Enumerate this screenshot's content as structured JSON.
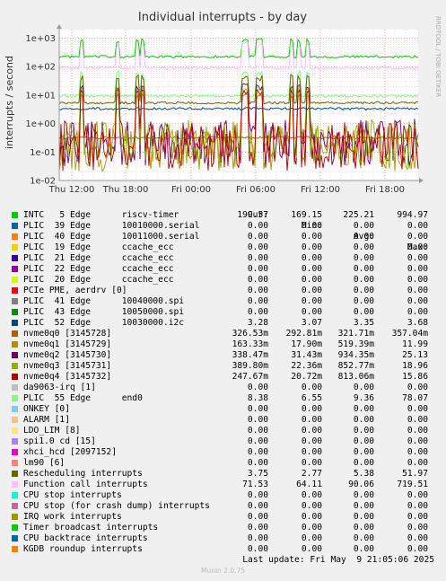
{
  "chart_data": {
    "type": "line",
    "title": "Individual interrupts - by day",
    "ylabel": "interrupts / second",
    "xlabel": "",
    "scale": "log",
    "ylim": [
      0.01,
      2000
    ],
    "grid": true,
    "y_ticks": [
      "1e+03",
      "1e+02",
      "1e+01",
      "1e+00",
      "1e-01",
      "1e-02"
    ],
    "x_ticks": [
      "Thu 12:00",
      "Thu 18:00",
      "Fri 00:00",
      "Fri 06:00",
      "Fri 12:00",
      "Fri 18:00"
    ],
    "side_label": "RRDTOOL / TOBI OETIKER",
    "columns": [
      "Cur:",
      "Min:",
      "Avg:",
      "Max:"
    ],
    "series": [
      {
        "name": "INTC   5 Edge      riscv-timer",
        "color": "#00cc00",
        "cur": "199.57",
        "min": "169.15",
        "avg": "225.21",
        "max": "994.97"
      },
      {
        "name": "PLIC  39 Edge      10010000.serial",
        "color": "#0066b3",
        "cur": "0.00",
        "min": "0.00",
        "avg": "0.00",
        "max": "0.00"
      },
      {
        "name": "PLIC  40 Edge      10011000.serial",
        "color": "#ff8000",
        "cur": "0.00",
        "min": "0.00",
        "avg": "0.00",
        "max": "0.00"
      },
      {
        "name": "PLIC  19 Edge      ccache_ecc",
        "color": "#ffcc00",
        "cur": "0.00",
        "min": "0.00",
        "avg": "0.00",
        "max": "0.00"
      },
      {
        "name": "PLIC  21 Edge      ccache_ecc",
        "color": "#330099",
        "cur": "0.00",
        "min": "0.00",
        "avg": "0.00",
        "max": "0.00"
      },
      {
        "name": "PLIC  22 Edge      ccache_ecc",
        "color": "#990099",
        "cur": "0.00",
        "min": "0.00",
        "avg": "0.00",
        "max": "0.00"
      },
      {
        "name": "PLIC  20 Edge      ccache_ecc",
        "color": "#ccff00",
        "cur": "0.00",
        "min": "0.00",
        "avg": "0.00",
        "max": "0.00"
      },
      {
        "name": "PCIe PME, aerdrv [0]",
        "color": "#ff0000",
        "cur": "0.00",
        "min": "0.00",
        "avg": "0.00",
        "max": "0.00"
      },
      {
        "name": "PLIC  41 Edge      10040000.spi",
        "color": "#808080",
        "cur": "0.00",
        "min": "0.00",
        "avg": "0.00",
        "max": "0.00"
      },
      {
        "name": "PLIC  43 Edge      10050000.spi",
        "color": "#008f00",
        "cur": "0.00",
        "min": "0.00",
        "avg": "0.00",
        "max": "0.00"
      },
      {
        "name": "PLIC  52 Edge      10030000.i2c",
        "color": "#00487d",
        "cur": "3.28",
        "min": "3.07",
        "avg": "3.35",
        "max": "3.68"
      },
      {
        "name": "nvme0q0 [3145728]",
        "color": "#b35a00",
        "cur": "326.53m",
        "min": "292.81m",
        "avg": "321.71m",
        "max": "357.04m"
      },
      {
        "name": "nvme0q1 [3145729]",
        "color": "#b38f00",
        "cur": "163.33m",
        "min": "17.90m",
        "avg": "519.39m",
        "max": "11.99"
      },
      {
        "name": "nvme0q2 [3145730]",
        "color": "#6b006b",
        "cur": "338.47m",
        "min": "31.43m",
        "avg": "934.35m",
        "max": "25.13"
      },
      {
        "name": "nvme0q3 [3145731]",
        "color": "#8fb300",
        "cur": "389.80m",
        "min": "22.36m",
        "avg": "852.77m",
        "max": "18.96"
      },
      {
        "name": "nvme0q4 [3145732]",
        "color": "#b30000",
        "cur": "247.67m",
        "min": "20.72m",
        "avg": "813.06m",
        "max": "15.86"
      },
      {
        "name": "da9063-irq [1]",
        "color": "#bebebe",
        "cur": "0.00",
        "min": "0.00",
        "avg": "0.00",
        "max": "0.00"
      },
      {
        "name": "PLIC  55 Edge      end0",
        "color": "#80ff80",
        "cur": "8.38",
        "min": "6.55",
        "avg": "9.36",
        "max": "78.07"
      },
      {
        "name": "ONKEY [0]",
        "color": "#80c9ff",
        "cur": "0.00",
        "min": "0.00",
        "avg": "0.00",
        "max": "0.00"
      },
      {
        "name": "ALARM [1]",
        "color": "#ffc080",
        "cur": "0.00",
        "min": "0.00",
        "avg": "0.00",
        "max": "0.00"
      },
      {
        "name": "LDO_LIM [8]",
        "color": "#ffe680",
        "cur": "0.00",
        "min": "0.00",
        "avg": "0.00",
        "max": "0.00"
      },
      {
        "name": "spi1.0 cd [15]",
        "color": "#aa80ff",
        "cur": "0.00",
        "min": "0.00",
        "avg": "0.00",
        "max": "0.00"
      },
      {
        "name": "xhci_hcd [2097152]",
        "color": "#ee00cc",
        "cur": "0.00",
        "min": "0.00",
        "avg": "0.00",
        "max": "0.00"
      },
      {
        "name": "lm90 [6]",
        "color": "#ff8080",
        "cur": "0.00",
        "min": "0.00",
        "avg": "0.00",
        "max": "0.00"
      },
      {
        "name": "Rescheduling interrupts",
        "color": "#666600",
        "cur": "3.75",
        "min": "2.77",
        "avg": "5.38",
        "max": "51.97"
      },
      {
        "name": "Function call interrupts",
        "color": "#ffbfff",
        "cur": "71.53",
        "min": "64.11",
        "avg": "90.06",
        "max": "719.51"
      },
      {
        "name": "CPU stop interrupts",
        "color": "#00ffcc",
        "cur": "0.00",
        "min": "0.00",
        "avg": "0.00",
        "max": "0.00"
      },
      {
        "name": "CPU stop (for crash dump) interrupts",
        "color": "#cc6699",
        "cur": "0.00",
        "min": "0.00",
        "avg": "0.00",
        "max": "0.00"
      },
      {
        "name": "IRQ work interrupts",
        "color": "#999900",
        "cur": "0.00",
        "min": "0.00",
        "avg": "0.00",
        "max": "0.00"
      },
      {
        "name": "Timer broadcast interrupts",
        "color": "#00cc00",
        "cur": "0.00",
        "min": "0.00",
        "avg": "0.00",
        "max": "0.00"
      },
      {
        "name": "CPU backtrace interrupts",
        "color": "#0066b3",
        "cur": "0.00",
        "min": "0.00",
        "avg": "0.00",
        "max": "0.00"
      },
      {
        "name": "KGDB roundup interrupts",
        "color": "#ff8000",
        "cur": "0.00",
        "min": "0.00",
        "avg": "0.00",
        "max": "0.00"
      }
    ]
  },
  "footer": {
    "last_update": "Last update: Fri May  9 21:05:06 2025",
    "munin": "Munin 2.0.75"
  }
}
